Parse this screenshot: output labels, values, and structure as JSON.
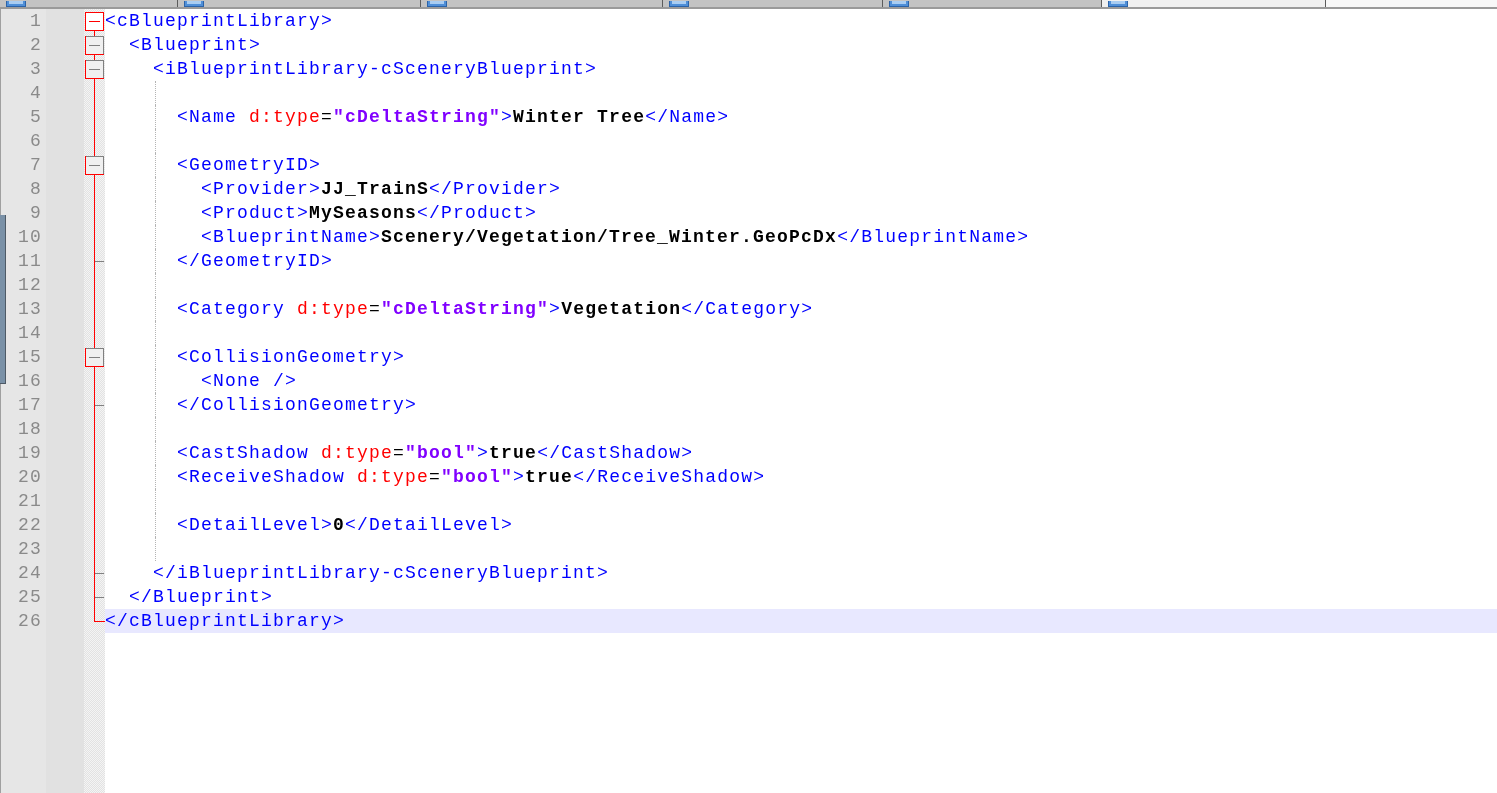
{
  "tabs": [
    {
      "selected": false
    },
    {
      "selected": false
    },
    {
      "selected": false
    },
    {
      "selected": false
    },
    {
      "selected": false
    },
    {
      "selected": true
    }
  ],
  "editor": {
    "lines": [
      {
        "number": "1",
        "kind": "fold_head",
        "current": false,
        "tokens": [
          {
            "kind": "tag",
            "text": "<cBlueprintLibrary>"
          }
        ]
      },
      {
        "number": "2",
        "kind": "fold_start",
        "current": false,
        "tokens": [
          {
            "kind": "tag",
            "text": "  <Blueprint>"
          }
        ]
      },
      {
        "number": "3",
        "kind": "fold_start",
        "current": false,
        "tokens": [
          {
            "kind": "tag",
            "text": "    <iBlueprintLibrary-cSceneryBlueprint>"
          }
        ]
      },
      {
        "number": "4",
        "kind": "fold_body",
        "current": false
      },
      {
        "number": "5",
        "kind": "fold_body",
        "current": false,
        "tokens": [
          {
            "kind": "tag",
            "text": "      <Name "
          },
          {
            "kind": "attr",
            "text": "d:type"
          },
          {
            "kind": "eq",
            "text": "="
          },
          {
            "kind": "value",
            "text": "\"cDeltaString\""
          },
          {
            "kind": "tag",
            "text": ">"
          },
          {
            "kind": "text",
            "text": "Winter Tree"
          },
          {
            "kind": "tag",
            "text": "</Name>"
          }
        ]
      },
      {
        "number": "6",
        "kind": "fold_body",
        "current": false
      },
      {
        "number": "7",
        "kind": "fold_start",
        "current": false,
        "tokens": [
          {
            "kind": "tag",
            "text": "      <GeometryID>"
          }
        ]
      },
      {
        "number": "8",
        "kind": "fold_body",
        "current": false,
        "tokens": [
          {
            "kind": "tag",
            "text": "        <Provider>"
          },
          {
            "kind": "text",
            "text": "JJ_TrainS"
          },
          {
            "kind": "tag",
            "text": "</Provider>"
          }
        ]
      },
      {
        "number": "9",
        "kind": "fold_body",
        "current": false,
        "tokens": [
          {
            "kind": "tag",
            "text": "        <Product>"
          },
          {
            "kind": "text",
            "text": "MySeasons"
          },
          {
            "kind": "tag",
            "text": "</Product>"
          }
        ]
      },
      {
        "number": "10",
        "kind": "fold_body",
        "current": false,
        "tokens": [
          {
            "kind": "tag",
            "text": "        <BlueprintName>"
          },
          {
            "kind": "text",
            "text": "Scenery/Vegetation/Tree_Winter.GeoPcDx"
          },
          {
            "kind": "tag",
            "text": "</BlueprintName>"
          }
        ]
      },
      {
        "number": "11",
        "kind": "fold_end",
        "current": false,
        "tokens": [
          {
            "kind": "tag",
            "text": "      </GeometryID>"
          }
        ]
      },
      {
        "number": "12",
        "kind": "fold_body",
        "current": false
      },
      {
        "number": "13",
        "kind": "fold_body",
        "current": false,
        "tokens": [
          {
            "kind": "tag",
            "text": "      <Category "
          },
          {
            "kind": "attr",
            "text": "d:type"
          },
          {
            "kind": "eq",
            "text": "="
          },
          {
            "kind": "value",
            "text": "\"cDeltaString\""
          },
          {
            "kind": "tag",
            "text": ">"
          },
          {
            "kind": "text",
            "text": "Vegetation"
          },
          {
            "kind": "tag",
            "text": "</Category>"
          }
        ]
      },
      {
        "number": "14",
        "kind": "fold_body",
        "current": false
      },
      {
        "number": "15",
        "kind": "fold_start",
        "current": false,
        "tokens": [
          {
            "kind": "tag",
            "text": "      <CollisionGeometry>"
          }
        ]
      },
      {
        "number": "16",
        "kind": "fold_body",
        "current": false,
        "tokens": [
          {
            "kind": "tag",
            "text": "        <None />"
          }
        ]
      },
      {
        "number": "17",
        "kind": "fold_end",
        "current": false,
        "tokens": [
          {
            "kind": "tag",
            "text": "      </CollisionGeometry>"
          }
        ]
      },
      {
        "number": "18",
        "kind": "fold_body",
        "current": false
      },
      {
        "number": "19",
        "kind": "fold_body",
        "current": false,
        "tokens": [
          {
            "kind": "tag",
            "text": "      <CastShadow "
          },
          {
            "kind": "attr",
            "text": "d:type"
          },
          {
            "kind": "eq",
            "text": "="
          },
          {
            "kind": "value",
            "text": "\"bool\""
          },
          {
            "kind": "tag",
            "text": ">"
          },
          {
            "kind": "text",
            "text": "true"
          },
          {
            "kind": "tag",
            "text": "</CastShadow>"
          }
        ]
      },
      {
        "number": "20",
        "kind": "fold_body",
        "current": false,
        "tokens": [
          {
            "kind": "tag",
            "text": "      <ReceiveShadow "
          },
          {
            "kind": "attr",
            "text": "d:type"
          },
          {
            "kind": "eq",
            "text": "="
          },
          {
            "kind": "value",
            "text": "\"bool\""
          },
          {
            "kind": "tag",
            "text": ">"
          },
          {
            "kind": "text",
            "text": "true"
          },
          {
            "kind": "tag",
            "text": "</ReceiveShadow>"
          }
        ]
      },
      {
        "number": "21",
        "kind": "fold_body",
        "current": false
      },
      {
        "number": "22",
        "kind": "fold_body",
        "current": false,
        "tokens": [
          {
            "kind": "tag",
            "text": "      <DetailLevel>"
          },
          {
            "kind": "text",
            "text": "0"
          },
          {
            "kind": "tag",
            "text": "</DetailLevel>"
          }
        ]
      },
      {
        "number": "23",
        "kind": "fold_body",
        "current": false
      },
      {
        "number": "24",
        "kind": "fold_end",
        "current": false,
        "tokens": [
          {
            "kind": "tag",
            "text": "    </iBlueprintLibrary-cSceneryBlueprint>"
          }
        ]
      },
      {
        "number": "25",
        "kind": "fold_end",
        "current": false,
        "tokens": [
          {
            "kind": "tag",
            "text": "  </Blueprint>"
          }
        ]
      },
      {
        "number": "26",
        "kind": "fold_last",
        "current": true,
        "tokens": [
          {
            "kind": "tag",
            "text": "</cBlueprintLibrary>"
          }
        ]
      }
    ]
  }
}
